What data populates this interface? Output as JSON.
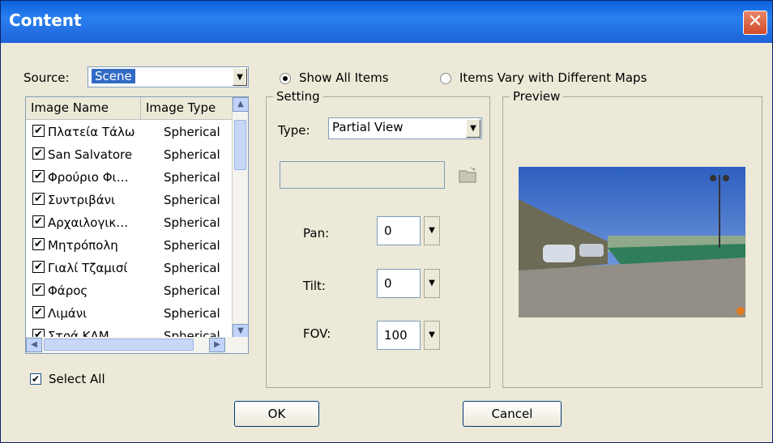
{
  "window": {
    "title": "Content",
    "close_label": "✕"
  },
  "source": {
    "label": "Source:",
    "value": "Scene"
  },
  "mode": {
    "show_all": "Show All Items",
    "vary": "Items Vary with Different Maps"
  },
  "list": {
    "col_name": "Image Name",
    "col_type": "Image Type",
    "rows": [
      {
        "name": "Πλατεία Τάλω",
        "type": "Spherical"
      },
      {
        "name": "San Salvatore",
        "type": "Spherical"
      },
      {
        "name": "Φρούριο Φι…",
        "type": "Spherical"
      },
      {
        "name": "Συντριβάνι",
        "type": "Spherical"
      },
      {
        "name": "Αρχαιλογικ…",
        "type": "Spherical"
      },
      {
        "name": "Μητρόπολη",
        "type": "Spherical"
      },
      {
        "name": "Γιαλί Τζαμισί",
        "type": "Spherical"
      },
      {
        "name": "Φάρος",
        "type": "Spherical"
      },
      {
        "name": "Λιμάνι",
        "type": "Spherical"
      },
      {
        "name": "Στρά ΚΑΜ",
        "type": "Spherical"
      }
    ]
  },
  "select_all": "Select All",
  "setting": {
    "group_label": "Setting",
    "type_label": "Type:",
    "type_value": "Partial View",
    "pan_label": "Pan:",
    "pan_value": "0",
    "tilt_label": "Tilt:",
    "tilt_value": "0",
    "fov_label": "FOV:",
    "fov_value": "100"
  },
  "preview": {
    "group_label": "Preview"
  },
  "buttons": {
    "ok": "OK",
    "cancel": "Cancel"
  },
  "colors": {
    "titlebar": "#1d63d8",
    "selection": "#316ac5",
    "dialog_bg": "#ece9d8"
  }
}
